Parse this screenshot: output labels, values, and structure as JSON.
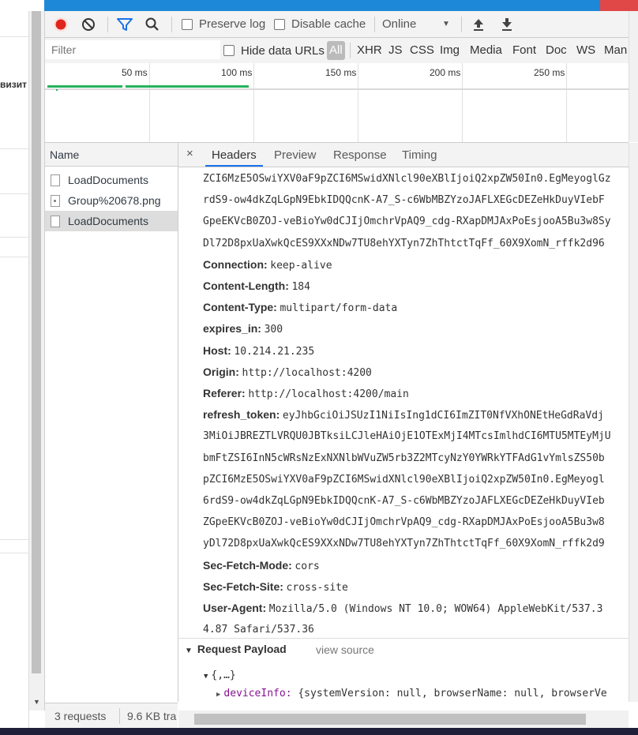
{
  "left_page": {
    "text": "визит"
  },
  "toolbar": {
    "preserve_log": "Preserve log",
    "disable_cache": "Disable cache",
    "throttle": "Online",
    "throttle_arrow": "▼"
  },
  "filter": {
    "placeholder": "Filter",
    "hide_data_urls": "Hide data URLs",
    "types": [
      "All",
      "XHR",
      "JS",
      "CSS",
      "Img",
      "Media",
      "Font",
      "Doc",
      "WS",
      "Man"
    ]
  },
  "timeline": {
    "ticks": [
      "50 ms",
      "100 ms",
      "150 ms",
      "200 ms",
      "250 ms"
    ]
  },
  "requests": {
    "header": "Name",
    "items": [
      {
        "name": "LoadDocuments",
        "icon": "document-icon",
        "selected": false
      },
      {
        "name": "Group%20678.png",
        "icon": "image-icon",
        "selected": false
      },
      {
        "name": "LoadDocuments",
        "icon": "document-icon",
        "selected": true
      }
    ]
  },
  "detail": {
    "close": "×",
    "tabs": [
      "Headers",
      "Preview",
      "Response",
      "Timing"
    ],
    "active_tab": "Headers",
    "header_lines": [
      {
        "key": "",
        "value": "ZCI6MzE5OSwiYXV0aF9pZCI6MSwidXNlcl90eXBlIjoiQ2xpZW50In0.EgMeyoglGz"
      },
      {
        "key": "",
        "value": "rdS9-ow4dkZqLGpN9EbkIDQQcnK-A7_S-c6WbMBZYzoJAFLXEGcDEZeHkDuyVIebF"
      },
      {
        "key": "",
        "value": "GpeEKVcB0ZOJ-veBioYw0dCJIjOmchrVpAQ9_cdg-RXapDMJAxPoEsjooA5Bu3w8Sy"
      },
      {
        "key": "",
        "value": "Dl72D8pxUaXwkQcES9XXxNDw7TU8ehYXTyn7ZhThtctTqFf_60X9XomN_rffk2d96"
      },
      {
        "key": "Connection:",
        "value": "keep-alive"
      },
      {
        "key": "Content-Length:",
        "value": "184"
      },
      {
        "key": "Content-Type:",
        "value": "multipart/form-data"
      },
      {
        "key": "expires_in:",
        "value": "300"
      },
      {
        "key": "Host:",
        "value": "10.214.21.235"
      },
      {
        "key": "Origin:",
        "value": "http://localhost:4200"
      },
      {
        "key": "Referer:",
        "value": "http://localhost:4200/main"
      },
      {
        "key": "refresh_token:",
        "value": "eyJhbGciOiJSUzI1NiIsIng1dCI6ImZIT0NfVXhONEtHeGdRaVdj"
      },
      {
        "key": "",
        "value": "3MiOiJBREZTLVRQU0JBTksiLCJleHAiOjE1OTExMjI4MTcsImlhdCI6MTU5MTEyMjU"
      },
      {
        "key": "",
        "value": "bmFtZSI6InN5cWRsNzExNXNlbWVuZW5rb3Z2MTcyNzY0YWRkYTFAdG1vYmlsZS50b"
      },
      {
        "key": "",
        "value": "pZCI6MzE5OSwiYXV0aF9pZCI6MSwidXNlcl90eXBlIjoiQ2xpZW50In0.EgMeyogl"
      },
      {
        "key": "",
        "value": "6rdS9-ow4dkZqLGpN9EbkIDQQcnK-A7_S-c6WbMBZYzoJAFLXEGcDEZeHkDuyVIeb"
      },
      {
        "key": "",
        "value": "ZGpeEKVcB0ZOJ-veBioYw0dCJIjOmchrVpAQ9_cdg-RXapDMJAxPoEsjooA5Bu3w8"
      },
      {
        "key": "",
        "value": "yDl72D8pxUaXwkQcES9XXxNDw7TU8ehYXTyn7ZhThtctTqFf_60X9XomN_rffk2d9"
      },
      {
        "key": "Sec-Fetch-Mode:",
        "value": "cors"
      },
      {
        "key": "Sec-Fetch-Site:",
        "value": "cross-site"
      },
      {
        "key": "User-Agent:",
        "value": "Mozilla/5.0 (Windows NT 10.0; WOW64) AppleWebKit/537.3"
      },
      {
        "key": "",
        "value": "4.87 Safari/537.36"
      }
    ],
    "payload": {
      "title": "Request Payload",
      "view_source": "view source",
      "root": "{,…}",
      "child_key": "deviceInfo:",
      "child_value": "{systemVersion: null, browserName: null, browserVe"
    }
  },
  "status": {
    "requests": "3 requests",
    "transferred": "9.6 KB tra"
  },
  "colors": {
    "record": "#e0261c",
    "filter_icon": "#1a73e8",
    "timeline_bar": "#27b35e",
    "payload_key": "#881391"
  }
}
